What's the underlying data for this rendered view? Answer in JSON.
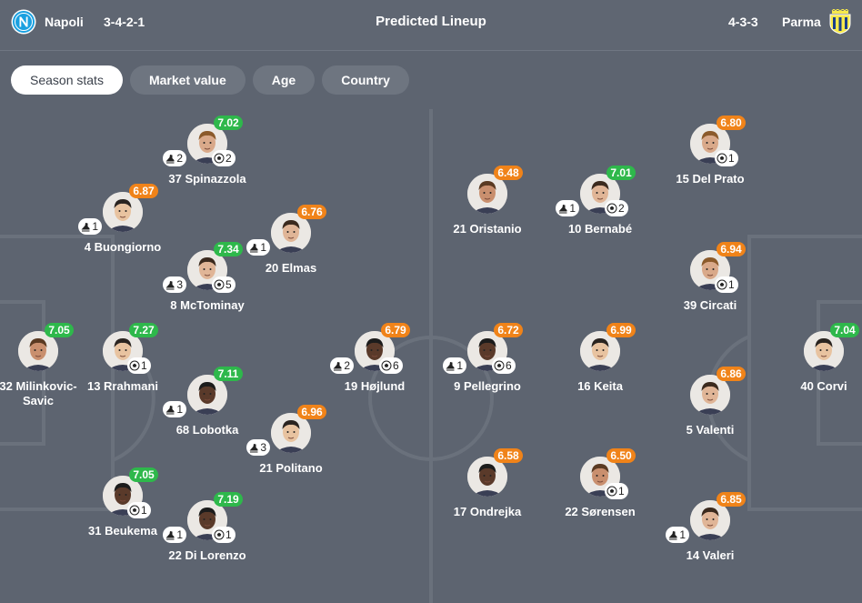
{
  "header": {
    "title": "Predicted Lineup",
    "home": {
      "name": "Napoli",
      "formation": "3-4-2-1"
    },
    "away": {
      "name": "Parma",
      "formation": "4-3-3"
    }
  },
  "tabs": [
    {
      "label": "Season stats",
      "active": true
    },
    {
      "label": "Market value",
      "active": false
    },
    {
      "label": "Age",
      "active": false
    },
    {
      "label": "Country",
      "active": false
    }
  ],
  "colors": {
    "rating_high": "#2eb84b",
    "rating_mid": "#f08319",
    "background": "#5d6470"
  },
  "players": {
    "home": [
      {
        "number": 32,
        "name": "Milinkovic-Savic",
        "rating": "7.05",
        "tier": "green",
        "assists": null,
        "goals": null
      },
      {
        "number": 4,
        "name": "Buongiorno",
        "rating": "6.87",
        "tier": "orange",
        "assists": 1,
        "goals": null
      },
      {
        "number": 13,
        "name": "Rrahmani",
        "rating": "7.27",
        "tier": "green",
        "assists": null,
        "goals": 1
      },
      {
        "number": 31,
        "name": "Beukema",
        "rating": "7.05",
        "tier": "green",
        "assists": null,
        "goals": 1
      },
      {
        "number": 37,
        "name": "Spinazzola",
        "rating": "7.02",
        "tier": "green",
        "assists": 2,
        "goals": 2
      },
      {
        "number": 8,
        "name": "McTominay",
        "rating": "7.34",
        "tier": "green",
        "assists": 3,
        "goals": 5
      },
      {
        "number": 68,
        "name": "Lobotka",
        "rating": "7.11",
        "tier": "green",
        "assists": 1,
        "goals": null
      },
      {
        "number": 22,
        "name": "Di Lorenzo",
        "rating": "7.19",
        "tier": "green",
        "assists": 1,
        "goals": 1
      },
      {
        "number": 20,
        "name": "Elmas",
        "rating": "6.76",
        "tier": "orange",
        "assists": 1,
        "goals": null
      },
      {
        "number": 21,
        "name": "Politano",
        "rating": "6.96",
        "tier": "orange",
        "assists": 3,
        "goals": null
      },
      {
        "number": 19,
        "name": "Højlund",
        "rating": "6.79",
        "tier": "orange",
        "assists": 2,
        "goals": 6
      }
    ],
    "away": [
      {
        "number": 9,
        "name": "Pellegrino",
        "rating": "6.72",
        "tier": "orange",
        "assists": 1,
        "goals": 6
      },
      {
        "number": 21,
        "name": "Oristanio",
        "rating": "6.48",
        "tier": "orange",
        "assists": null,
        "goals": null
      },
      {
        "number": 17,
        "name": "Ondrejka",
        "rating": "6.58",
        "tier": "orange",
        "assists": null,
        "goals": null
      },
      {
        "number": 10,
        "name": "Bernabé",
        "rating": "7.01",
        "tier": "green",
        "assists": 1,
        "goals": 2
      },
      {
        "number": 16,
        "name": "Keita",
        "rating": "6.99",
        "tier": "orange",
        "assists": null,
        "goals": null
      },
      {
        "number": 22,
        "name": "Sørensen",
        "rating": "6.50",
        "tier": "orange",
        "assists": null,
        "goals": 1
      },
      {
        "number": 15,
        "name": "Del Prato",
        "rating": "6.80",
        "tier": "orange",
        "assists": null,
        "goals": 1
      },
      {
        "number": 39,
        "name": "Circati",
        "rating": "6.94",
        "tier": "orange",
        "assists": null,
        "goals": 1
      },
      {
        "number": 5,
        "name": "Valenti",
        "rating": "6.86",
        "tier": "orange",
        "assists": null,
        "goals": null
      },
      {
        "number": 14,
        "name": "Valeri",
        "rating": "6.85",
        "tier": "orange",
        "assists": 1,
        "goals": null
      },
      {
        "number": 40,
        "name": "Corvi",
        "rating": "7.04",
        "tier": "green",
        "assists": null,
        "goals": null
      }
    ]
  }
}
